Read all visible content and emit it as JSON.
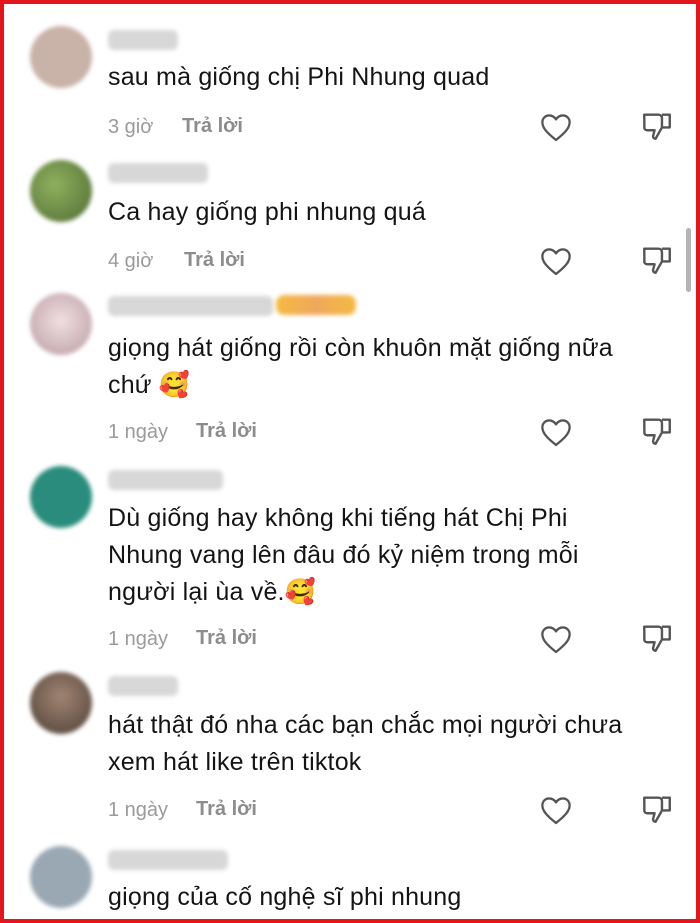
{
  "reply_label": "Trả lời",
  "comments": [
    {
      "text": "sau mà giống chị Phi Nhung quad",
      "time": "3 giờ",
      "avatar_color": "#c9b2a8"
    },
    {
      "text": "Ca hay giống phi nhung quá",
      "time": "4 giờ",
      "avatar_color": "#6f8a4a"
    },
    {
      "text": "giọng hát giống rồi còn khuôn mặt giống nữa\nchứ 🥰",
      "time": "1 ngày",
      "avatar_color": "#d8c1c6"
    },
    {
      "text": "Dù giống hay không khi tiếng hát Chị Phi\nNhung vang lên đâu đó kỷ niệm trong mỗi\nngười lại ùa về.🥰",
      "time": "1 ngày",
      "avatar_color": "#2a8c7c"
    },
    {
      "text": "hát thật đó nha các bạn chắc mọi người chưa\nxem hát like trên tiktok",
      "time": "1 ngày",
      "avatar_color": "#6b5a4e"
    },
    {
      "text": "giọng của cố nghệ sĩ phi nhung",
      "time": "",
      "avatar_color": "#9aa8b4"
    }
  ],
  "icons": {
    "like": "heart-icon",
    "dislike": "thumbs-down-icon"
  },
  "colors": {
    "frame": "#e3161c",
    "text": "#141414",
    "meta": "#9a9a9a"
  }
}
